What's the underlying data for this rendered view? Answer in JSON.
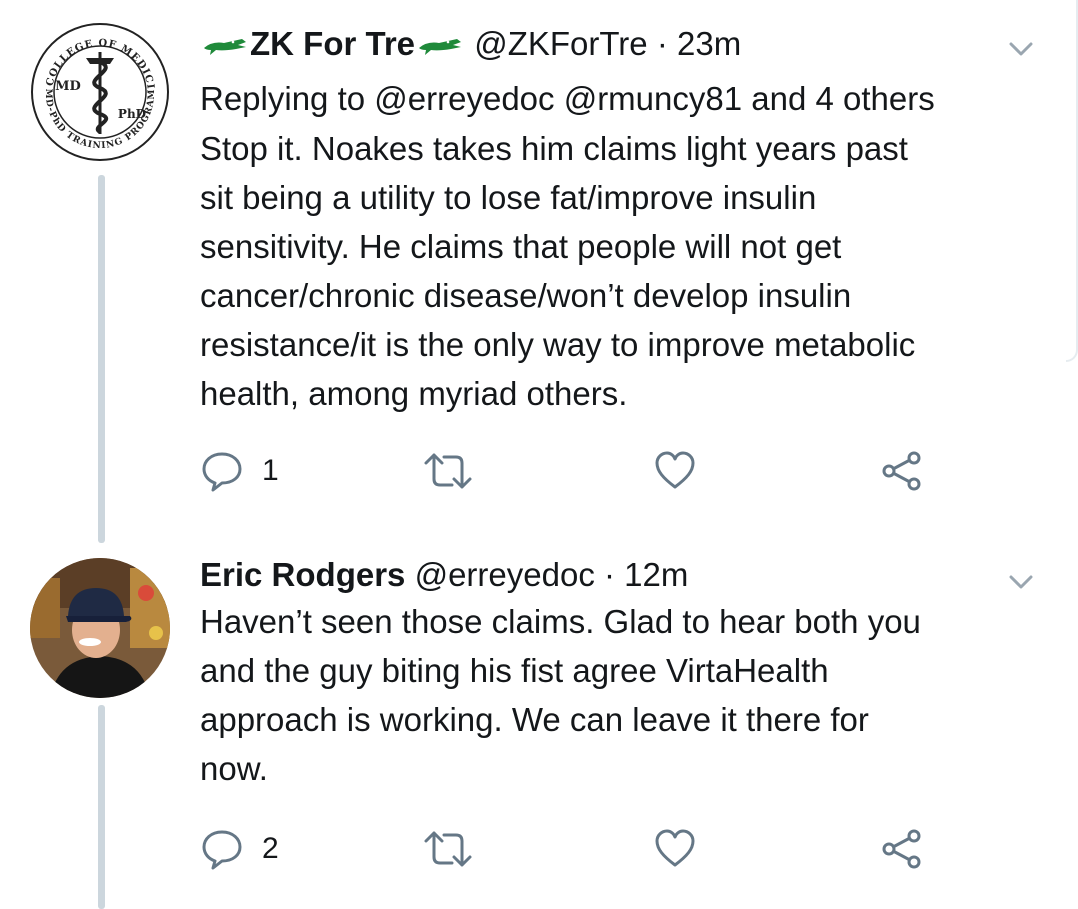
{
  "tweets": [
    {
      "name": "ZK For Tre",
      "handle": "@ZKForTre",
      "separator": "·",
      "time": "23m",
      "reply_prefix": "Replying to",
      "reply_mentions": "@erreyedoc @rmuncy81 and 4 others",
      "text": "Stop it. Noakes takes him claims light years past\nsit being a utility to lose fat/improve insulin\nsensitivity. He claims that people will not get\ncancer/chronic disease/won’t develop insulin\nresistance/it is the only way to improve metabolic\nhealth, among myriad others.",
      "reply_count": "1",
      "avatar": {
        "seal_top": "UF COLLEGE OF MEDICINE",
        "seal_bottom": "MD-PhD TRAINING PROGRAM",
        "left_mark": "MD",
        "right_mark": "PhD"
      }
    },
    {
      "name": "Eric Rodgers",
      "handle": "@erreyedoc",
      "separator": "·",
      "time": "12m",
      "text": "Haven’t seen those claims. Glad to hear both you\nand the guy biting his fist agree VirtaHealth\napproach is working. We can leave it there for\nnow.",
      "reply_count": "2"
    }
  ],
  "icons": {
    "reply": "speech-bubble-icon",
    "retweet": "retweet-icon",
    "like": "heart-icon",
    "share": "share-icon",
    "menu": "chevron-down-icon",
    "name_decoration": "alligator-icon"
  },
  "colors": {
    "text": "#14171a",
    "icon": "#657786",
    "thread_line": "#ccd6dd",
    "gator": "#1f8a3a"
  }
}
